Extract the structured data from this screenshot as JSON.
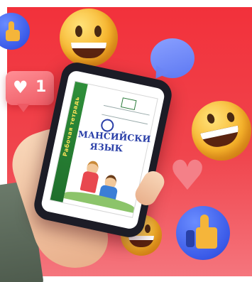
{
  "like_badge": {
    "count": "1",
    "icon": "heart-icon"
  },
  "book_cover": {
    "title_line1": "МАНСИЙСКИ",
    "title_line2": "ЯЗЫК",
    "spine_label": "Рабочая тетрадь"
  },
  "colors": {
    "background": "#f2303a",
    "emoji_yellow": "#f7b52c",
    "badge_blue": "#3a5ae8",
    "cover_green": "#2f8f3a",
    "cover_title_blue": "#2a3fa8"
  },
  "icons": [
    "laughing-emoji-icon",
    "thumbs-up-icon",
    "chat-bubble-icon",
    "heart-icon",
    "phone-icon"
  ]
}
